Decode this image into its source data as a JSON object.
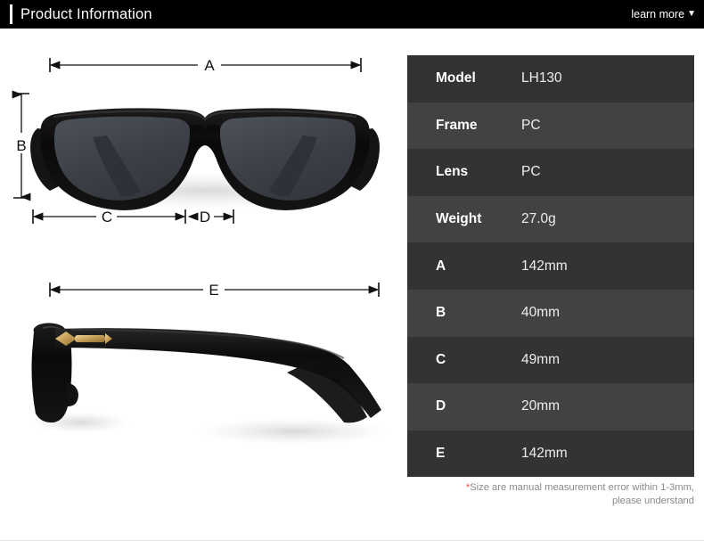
{
  "header": {
    "title": "Product Information",
    "learn_more_label": "learn more",
    "caret": "▼",
    "background_color": "#000000",
    "text_color": "#ffffff"
  },
  "diagram": {
    "front_view": {
      "dimension_labels": [
        "A",
        "B",
        "C",
        "D"
      ],
      "a_label": "A",
      "b_label": "B",
      "c_label": "C",
      "d_label": "D"
    },
    "side_view": {
      "e_label": "E"
    },
    "frame_color": "#0d0d0d",
    "lens_color": "#3f4349",
    "accent_color": "#d8b265"
  },
  "spec_table": {
    "row_color_odd": "#333333",
    "row_color_even": "#424242",
    "rows": [
      {
        "label": "Model",
        "value": "LH130"
      },
      {
        "label": "Frame",
        "value": "PC"
      },
      {
        "label": "Lens",
        "value": "PC"
      },
      {
        "label": "Weight",
        "value": "27.0g"
      },
      {
        "label": "A",
        "value": "142mm"
      },
      {
        "label": "B",
        "value": "40mm"
      },
      {
        "label": "C",
        "value": "49mm"
      },
      {
        "label": "D",
        "value": "20mm"
      },
      {
        "label": "E",
        "value": "142mm"
      }
    ]
  },
  "footnote": {
    "star": "*",
    "line1": "Size are manual measurement error within 1-3mm,",
    "line2": "please understand",
    "star_color": "#e8493f"
  }
}
